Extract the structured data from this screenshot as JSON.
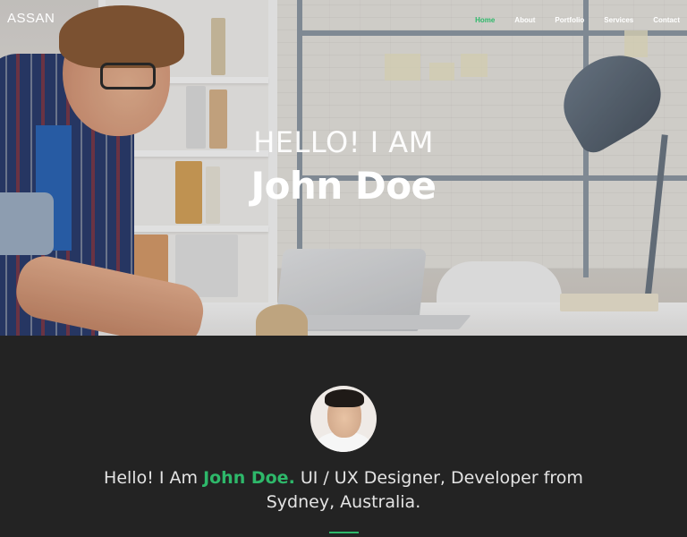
{
  "brand": {
    "logo": "ASSAN",
    "accent_color": "#2eb86a"
  },
  "nav": {
    "items": [
      {
        "label": "Home",
        "active": true
      },
      {
        "label": "About",
        "active": false
      },
      {
        "label": "Portfolio",
        "active": false
      },
      {
        "label": "Services",
        "active": false
      },
      {
        "label": "Contact",
        "active": false
      }
    ]
  },
  "hero": {
    "greeting": "HELLO! I AM",
    "name": "John Doe"
  },
  "about": {
    "intro_prefix": "Hello! I Am ",
    "intro_name": "John Doe.",
    "intro_suffix": " UI / UX Designer, Developer from Sydney, Australia."
  }
}
